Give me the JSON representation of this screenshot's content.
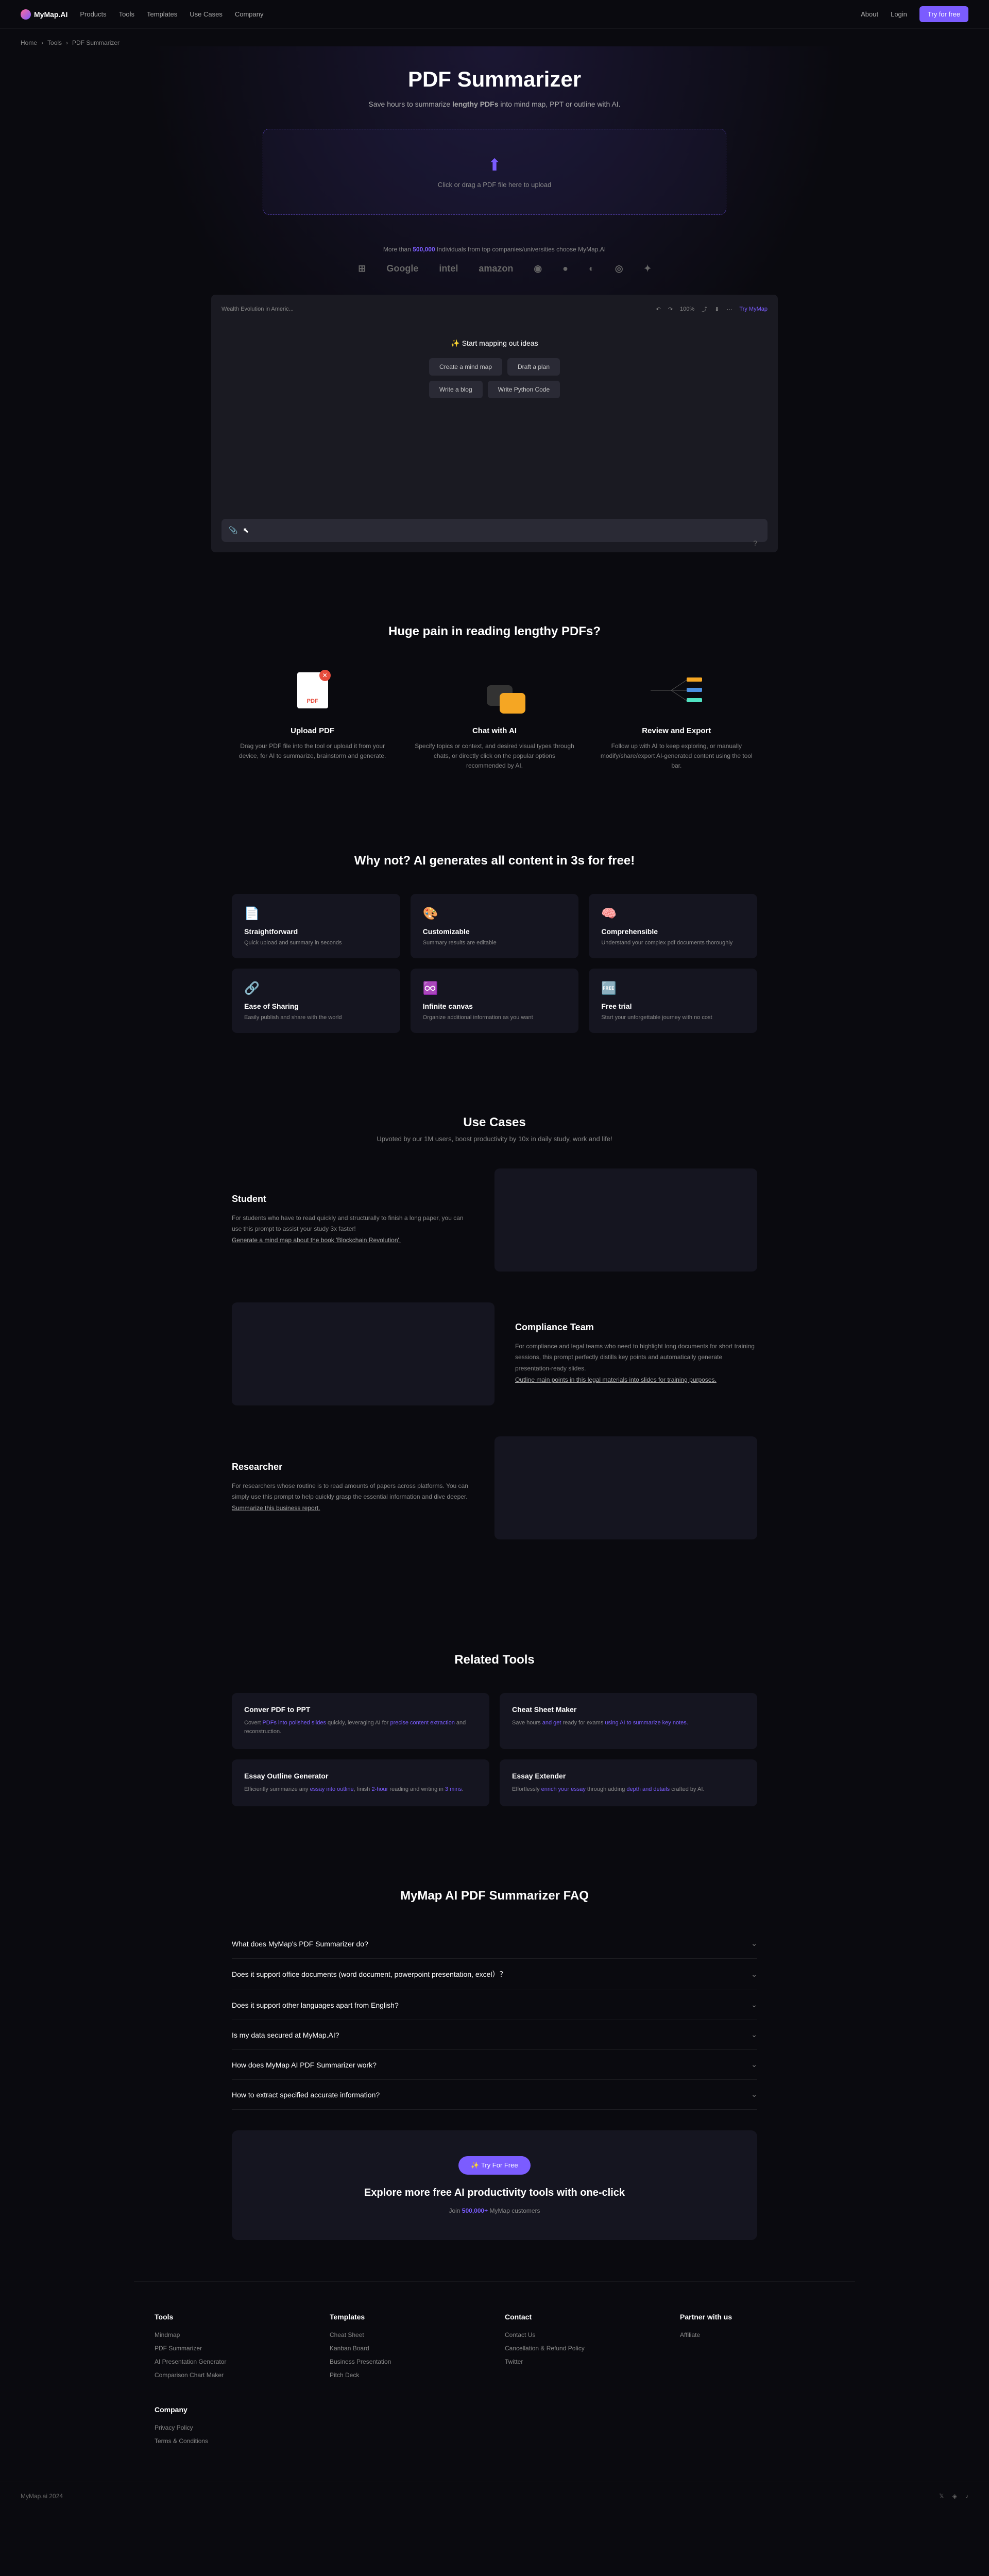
{
  "nav": {
    "logo": "MyMap.AI",
    "links": [
      "Products",
      "Tools",
      "Templates",
      "Use Cases",
      "Company"
    ],
    "about": "About",
    "login": "Login",
    "cta": "Try for free"
  },
  "breadcrumb": [
    "Home",
    "Tools",
    "PDF Summarizer"
  ],
  "hero": {
    "title": "PDF Summarizer",
    "sub_pre": "Save hours to summarize ",
    "sub_bold": "lengthy PDFs",
    "sub_post": " into mind map, PPT or outline with AI.",
    "upload": "Click or drag a PDF file here to upload",
    "trust_pre": "More than ",
    "trust_num": "500,000",
    "trust_post": " Individuals from top companies/universities choose MyMap.AI"
  },
  "logos": [
    "",
    "",
    "Google",
    "intel",
    "amazon",
    "",
    "",
    "",
    "",
    ""
  ],
  "preview": {
    "title": "Wealth Evolution in Americ...",
    "prompt": "Start mapping out ideas",
    "chips": [
      [
        "Create a mind map",
        "Draft a plan"
      ],
      [
        "Write a blog",
        "Write Python Code"
      ]
    ],
    "try": "Try MyMap",
    "zoom": "100%"
  },
  "pain": {
    "title": "Huge pain in reading lengthy PDFs?",
    "steps": [
      {
        "title": "Upload PDF",
        "desc": "Drag your PDF file into the tool or upload it from your device, for AI to summarize, brainstorm and generate."
      },
      {
        "title": "Chat with AI",
        "desc": "Specify topics or context, and desired visual types through chats, or directly click on the popular options recommended by AI."
      },
      {
        "title": "Review and Export",
        "desc": "Follow up with AI to keep exploring, or manually modify/share/export AI-generated content using the tool bar."
      }
    ]
  },
  "why": {
    "title": "Why not? AI generates all content in 3s for free!",
    "features": [
      {
        "icon": "📄",
        "title": "Straightforward",
        "desc": "Quick upload and summary in seconds"
      },
      {
        "icon": "🎨",
        "title": "Customizable",
        "desc": "Summary results are editable"
      },
      {
        "icon": "🧠",
        "title": "Comprehensible",
        "desc": "Understand your complex pdf documents thoroughly"
      },
      {
        "icon": "🔗",
        "title": "Ease of Sharing",
        "desc": "Easily publish and share with the world"
      },
      {
        "icon": "♾️",
        "title": "Infinite canvas",
        "desc": "Organize additional information as you want"
      },
      {
        "icon": "🆓",
        "title": "Free trial",
        "desc": "Start your unforgettable journey with no cost"
      }
    ]
  },
  "usecases": {
    "title": "Use Cases",
    "sub": "Upvoted by our 1M users, boost productivity by 10x in daily study, work and life!",
    "items": [
      {
        "title": "Student",
        "desc": "For students who have to read quickly and structurally to finish a long paper, you can use this prompt to assist your study 3x faster!",
        "link": "Generate a mind map about the book 'Blockchain Revolution'."
      },
      {
        "title": "Compliance Team",
        "desc": "For compliance and legal teams who need to highlight long documents for short training sessions, this prompt perfectly distills key points and automatically generate presentation-ready slides.",
        "link": "Outline main points in this legal materials into slides for training purposes."
      },
      {
        "title": "Researcher",
        "desc": "For researchers whose routine is to read amounts of papers across platforms. You can simply use this prompt to help quickly grasp the essential information and dive deeper.",
        "link": "Summarize this business report."
      }
    ]
  },
  "related": {
    "title": "Related Tools",
    "items": [
      {
        "title": "Conver PDF to PPT",
        "desc_parts": [
          "Covert ",
          "PDFs into polished slides",
          " quickly, leveraging AI for ",
          "precise content extraction",
          " and reconstruction."
        ]
      },
      {
        "title": "Cheat Sheet Maker",
        "desc_parts": [
          "Save hours",
          " and get ",
          "ready for exams",
          " using AI to summarize key notes."
        ]
      },
      {
        "title": "Essay Outline Generator",
        "desc_parts": [
          "Efficiently summarize any ",
          "essay into outline",
          ", finish ",
          "2-hour",
          " reading and writing in ",
          "3 mins",
          "."
        ]
      },
      {
        "title": "Essay Extender",
        "desc_parts": [
          "Effortlessly ",
          "enrich your essay",
          " through adding ",
          "depth and details",
          " crafted by AI."
        ]
      }
    ]
  },
  "faq": {
    "title": "MyMap AI PDF Summarizer FAQ",
    "items": [
      "What does MyMap's PDF Summarizer do?",
      "Does it support office documents (word document, powerpoint presentation, excel）？",
      "Does it support other languages apart from English?",
      "Is my data secured at MyMap.AI?",
      "How does MyMap AI PDF Summarizer work?",
      "How to extract specified accurate information?"
    ]
  },
  "cta": {
    "btn": "Try For Free",
    "title": "Explore more free AI productivity tools with one-click",
    "sub_pre": "Join ",
    "sub_num": "500,000+",
    "sub_post": " MyMap customers"
  },
  "footer": {
    "cols": [
      {
        "title": "Tools",
        "links": [
          "Mindmap",
          "PDF Summarizer",
          "AI Presentation Generator",
          "Comparison Chart Maker"
        ]
      },
      {
        "title": "Templates",
        "links": [
          "Cheat Sheet",
          "Kanban Board",
          "Business Presentation",
          "Pitch Deck"
        ]
      },
      {
        "title": "Contact",
        "links": [
          "Contact Us",
          "Cancellation & Refund Policy",
          "Twitter"
        ]
      },
      {
        "title": "Partner with us",
        "links": [
          "Affiliate"
        ]
      },
      {
        "title": "Company",
        "links": [
          "Privacy Policy",
          "Terms & Conditions"
        ]
      }
    ],
    "copyright": "MyMap.ai 2024"
  }
}
